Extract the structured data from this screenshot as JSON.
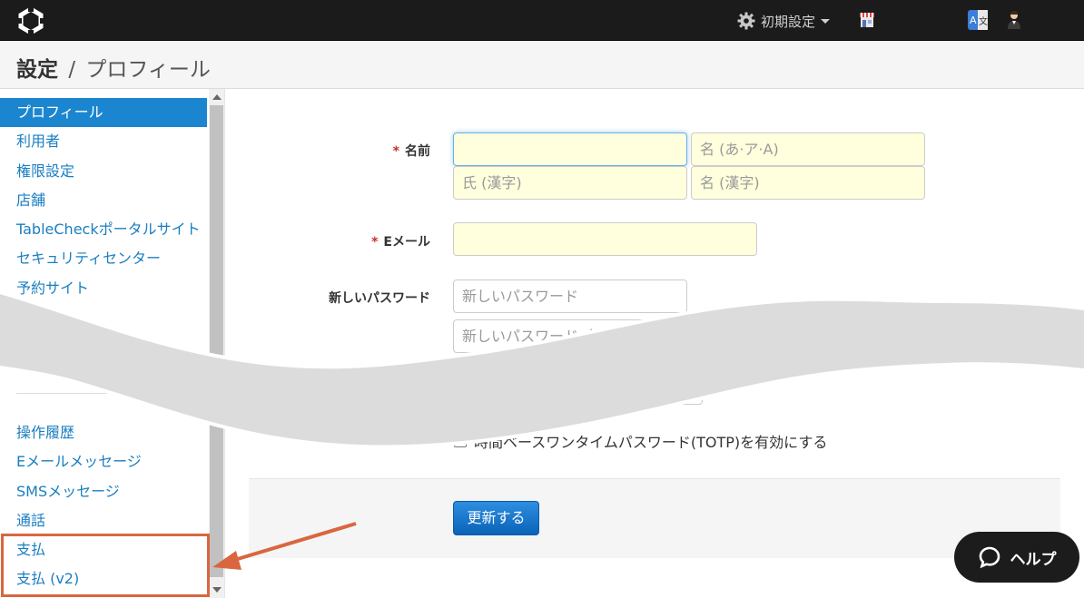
{
  "nav": {
    "settings_label": "初期設定"
  },
  "header": {
    "title": "設定",
    "separator": "/",
    "subtitle": "プロフィール"
  },
  "sidebar": {
    "items": [
      {
        "label": "プロフィール",
        "active": true
      },
      {
        "label": "利用者"
      },
      {
        "label": "権限設定"
      },
      {
        "label": "店舗"
      },
      {
        "label": "TableCheckポータルサイト"
      },
      {
        "label": "セキュリティセンター"
      },
      {
        "label": "予約サイト"
      }
    ],
    "items_bottom": [
      {
        "label": "操作履歴"
      },
      {
        "label": "Eメールメッセージ"
      },
      {
        "label": "SMSメッセージ"
      },
      {
        "label": "通話"
      },
      {
        "label": "支払"
      },
      {
        "label": "支払 (v2)"
      }
    ]
  },
  "form": {
    "required_mark": "*",
    "name_label": "名前",
    "email_label": "Eメール",
    "password_label": "新しいパスワード",
    "first_name_kana_placeholder": "名 (あ·ア·A)",
    "last_name_kanji_placeholder": "氏 (漢字)",
    "first_name_kanji_placeholder": "名 (漢字)",
    "password_placeholder": "新しいパスワード",
    "password_confirm_placeholder": "新しいパスワード（確",
    "totp_label": "時間ベースワンタイムパスワード(TOTP)を有効にする",
    "submit_label": "更新する"
  },
  "help": {
    "label": "ヘルプ"
  },
  "colors": {
    "accent": "#1b86cf",
    "annotation": "#d9663f",
    "input_highlight": "#ffffdd"
  }
}
